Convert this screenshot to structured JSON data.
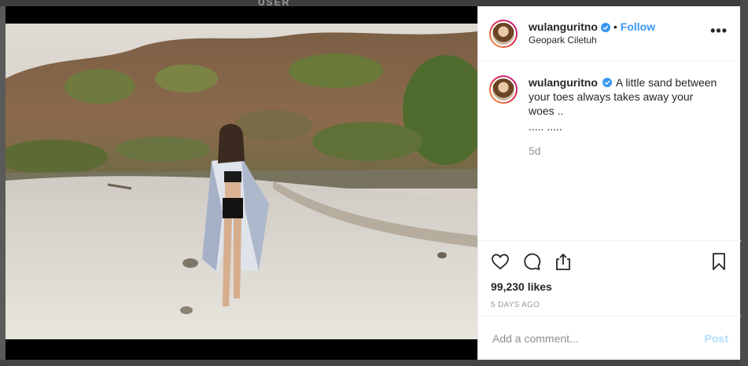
{
  "background_feed": {
    "text": "USER"
  },
  "post": {
    "username": "wulanguritno",
    "verified": true,
    "follow_label": "Follow",
    "separator": "•",
    "location": "Geopark Ciletuh",
    "caption": "A little sand between your toes always takes away your woes ..",
    "caption_extra": "..... .....",
    "time_ago": "5d",
    "likes": "99,230 likes",
    "date": "5 DAYS AGO",
    "more_label": "•••"
  },
  "comment_box": {
    "placeholder": "Add a comment...",
    "post_label": "Post"
  },
  "colors": {
    "accent": "#3897f0",
    "post_disabled": "#b2dffc",
    "verified": "#3897f0"
  },
  "icons": [
    "heart-icon",
    "comment-icon",
    "share-icon",
    "bookmark-icon",
    "verified-icon",
    "more-icon"
  ]
}
